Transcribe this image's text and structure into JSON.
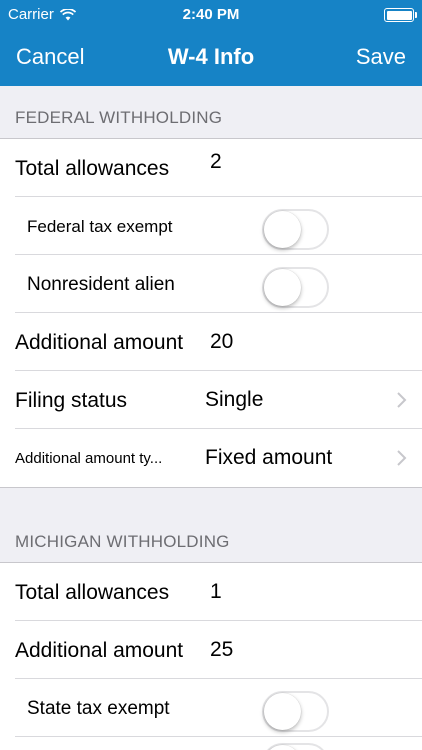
{
  "status_bar": {
    "carrier": "Carrier",
    "time": "2:40 PM",
    "wifi_icon": "wifi-icon",
    "battery_icon": "battery-icon"
  },
  "nav": {
    "cancel_label": "Cancel",
    "title": "W-4 Info",
    "save_label": "Save"
  },
  "colors": {
    "accent": "#1683c6",
    "background": "#efeff4",
    "section_text": "#6d6d72"
  },
  "federal": {
    "header": "FEDERAL WITHHOLDING",
    "total_allowances_label": "Total allowances",
    "total_allowances_value": "2",
    "tax_exempt_label": "Federal tax exempt",
    "tax_exempt_on": false,
    "nonresident_label": "Nonresident alien",
    "nonresident_on": false,
    "additional_amount_label": "Additional amount",
    "additional_amount_value": "20",
    "filing_status_label": "Filing status",
    "filing_status_value": "Single",
    "additional_type_label": "Additional amount ty...",
    "additional_type_value": "Fixed amount"
  },
  "michigan": {
    "header": "MICHIGAN WITHHOLDING",
    "total_allowances_label": "Total allowances",
    "total_allowances_value": "1",
    "additional_amount_label": "Additional amount",
    "additional_amount_value": "25",
    "tax_exempt_label": "State tax exempt",
    "tax_exempt_on": false
  }
}
